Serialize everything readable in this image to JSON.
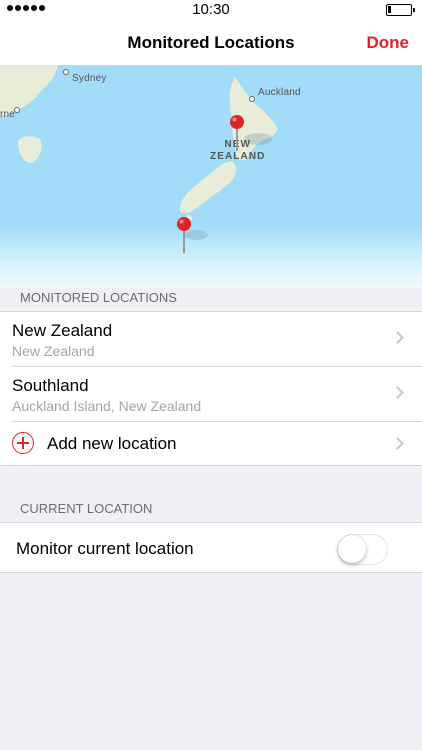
{
  "status_bar": {
    "time": "10:30",
    "signal_icon": "signal-dots-icon",
    "battery_icon": "battery-icon"
  },
  "nav": {
    "title": "Monitored Locations",
    "done_label": "Done",
    "accent_color": "#e0222a"
  },
  "map": {
    "labels": {
      "sydney": "Sydney",
      "auckland": "Auckland",
      "partial": "rne",
      "region_line1": "NEW",
      "region_line2": "ZEALAND"
    },
    "pin_icon": "map-pin-icon",
    "water_color": "#a2dcf8",
    "land_color": "#e8ecd8"
  },
  "monitored": {
    "header": "MONITORED LOCATIONS",
    "items": [
      {
        "title": "New Zealand",
        "subtitle": "New Zealand"
      },
      {
        "title": "Southland",
        "subtitle": "Auckland Island, New Zealand"
      }
    ],
    "add_label": "Add new location",
    "add_icon": "plus-circle-icon",
    "chevron_icon": "chevron-right-icon"
  },
  "current": {
    "header": "CURRENT LOCATION",
    "toggle_label": "Monitor current location",
    "toggle_on": false
  }
}
